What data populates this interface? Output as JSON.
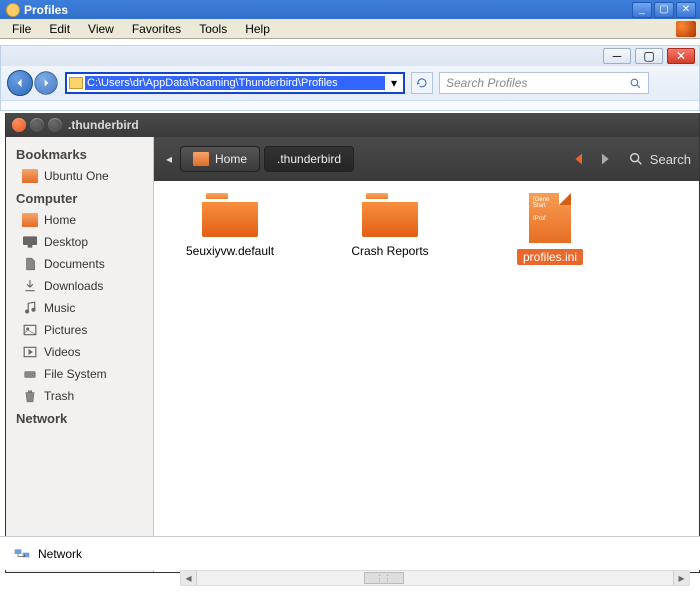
{
  "winxp": {
    "title": "Profiles",
    "menu": [
      "File",
      "Edit",
      "View",
      "Favorites",
      "Tools",
      "Help"
    ]
  },
  "explorer": {
    "address": "C:\\Users\\dr\\AppData\\Roaming\\Thunderbird\\Profiles",
    "search_placeholder": "Search Profiles"
  },
  "ubuntu": {
    "window_title": ".thunderbird",
    "pathbar": {
      "home": "Home",
      "current": ".thunderbird",
      "search": "Search"
    },
    "sidebar": {
      "bookmarks_header": "Bookmarks",
      "bookmarks": [
        {
          "label": "Ubuntu One"
        }
      ],
      "computer_header": "Computer",
      "computer": [
        {
          "label": "Home"
        },
        {
          "label": "Desktop"
        },
        {
          "label": "Documents"
        },
        {
          "label": "Downloads"
        },
        {
          "label": "Music"
        },
        {
          "label": "Pictures"
        },
        {
          "label": "Videos"
        },
        {
          "label": "File System"
        },
        {
          "label": "Trash"
        }
      ],
      "network_header": "Network"
    },
    "items": [
      {
        "label": "5euxiyvw.default",
        "kind": "folder",
        "selected": false
      },
      {
        "label": "Crash Reports",
        "kind": "folder",
        "selected": false
      },
      {
        "label": "profiles.ini",
        "kind": "file",
        "selected": true,
        "preview1": "[Gene",
        "preview2": "Start",
        "preview3": "IProf"
      }
    ]
  },
  "bottom": {
    "network": "Network"
  }
}
